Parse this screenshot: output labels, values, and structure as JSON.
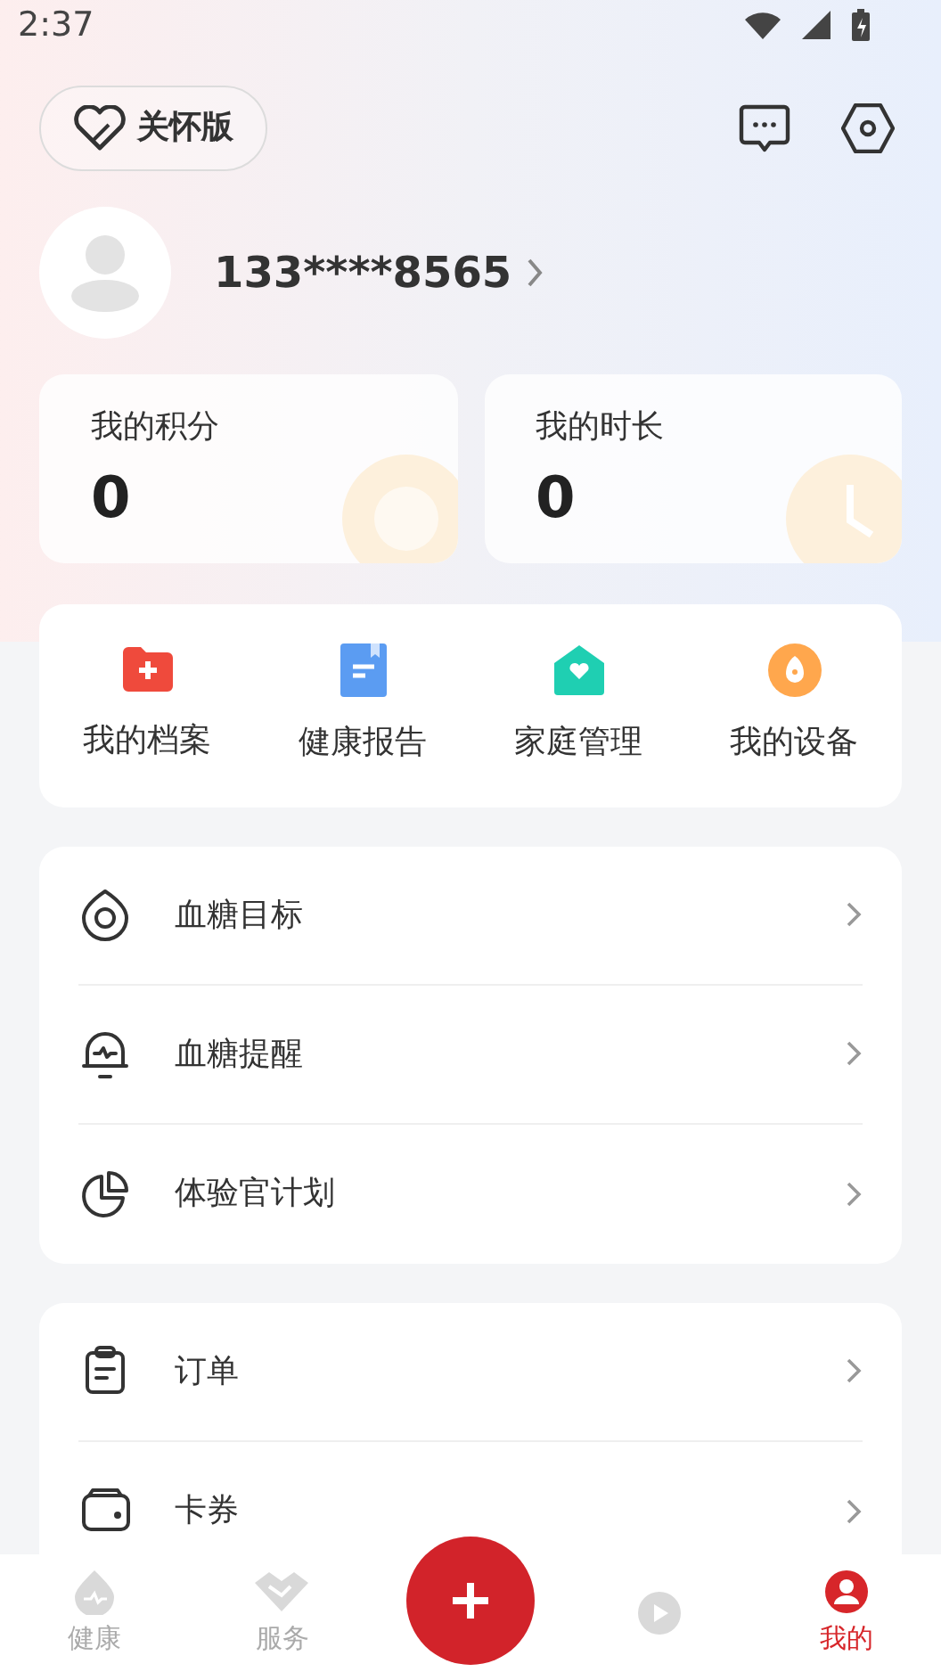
{
  "status_bar": {
    "time": "2:37"
  },
  "header": {
    "care_button": "关怀版"
  },
  "profile": {
    "phone": "133****8565"
  },
  "stats": [
    {
      "label": "我的积分",
      "value": "0",
      "kind": "points"
    },
    {
      "label": "我的时长",
      "value": "0",
      "kind": "time"
    }
  ],
  "shortcuts": [
    {
      "label": "我的档案",
      "kind": "folder"
    },
    {
      "label": "健康报告",
      "kind": "report"
    },
    {
      "label": "家庭管理",
      "kind": "home"
    },
    {
      "label": "我的设备",
      "kind": "device"
    }
  ],
  "menu_groups": [
    [
      {
        "label": "血糖目标",
        "kind": "target"
      },
      {
        "label": "血糖提醒",
        "kind": "bell"
      },
      {
        "label": "体验官计划",
        "kind": "pie"
      }
    ],
    [
      {
        "label": "订单",
        "kind": "clipboard"
      },
      {
        "label": "卡券",
        "kind": "wallet"
      }
    ]
  ],
  "bottom_nav": [
    {
      "label": "健康",
      "kind": "drop",
      "selected": false
    },
    {
      "label": "服务",
      "kind": "handshake",
      "selected": false
    },
    {
      "kind": "add",
      "selected": false
    },
    {
      "kind": "media",
      "selected": false
    },
    {
      "label": "我的",
      "kind": "person",
      "selected": true
    }
  ]
}
